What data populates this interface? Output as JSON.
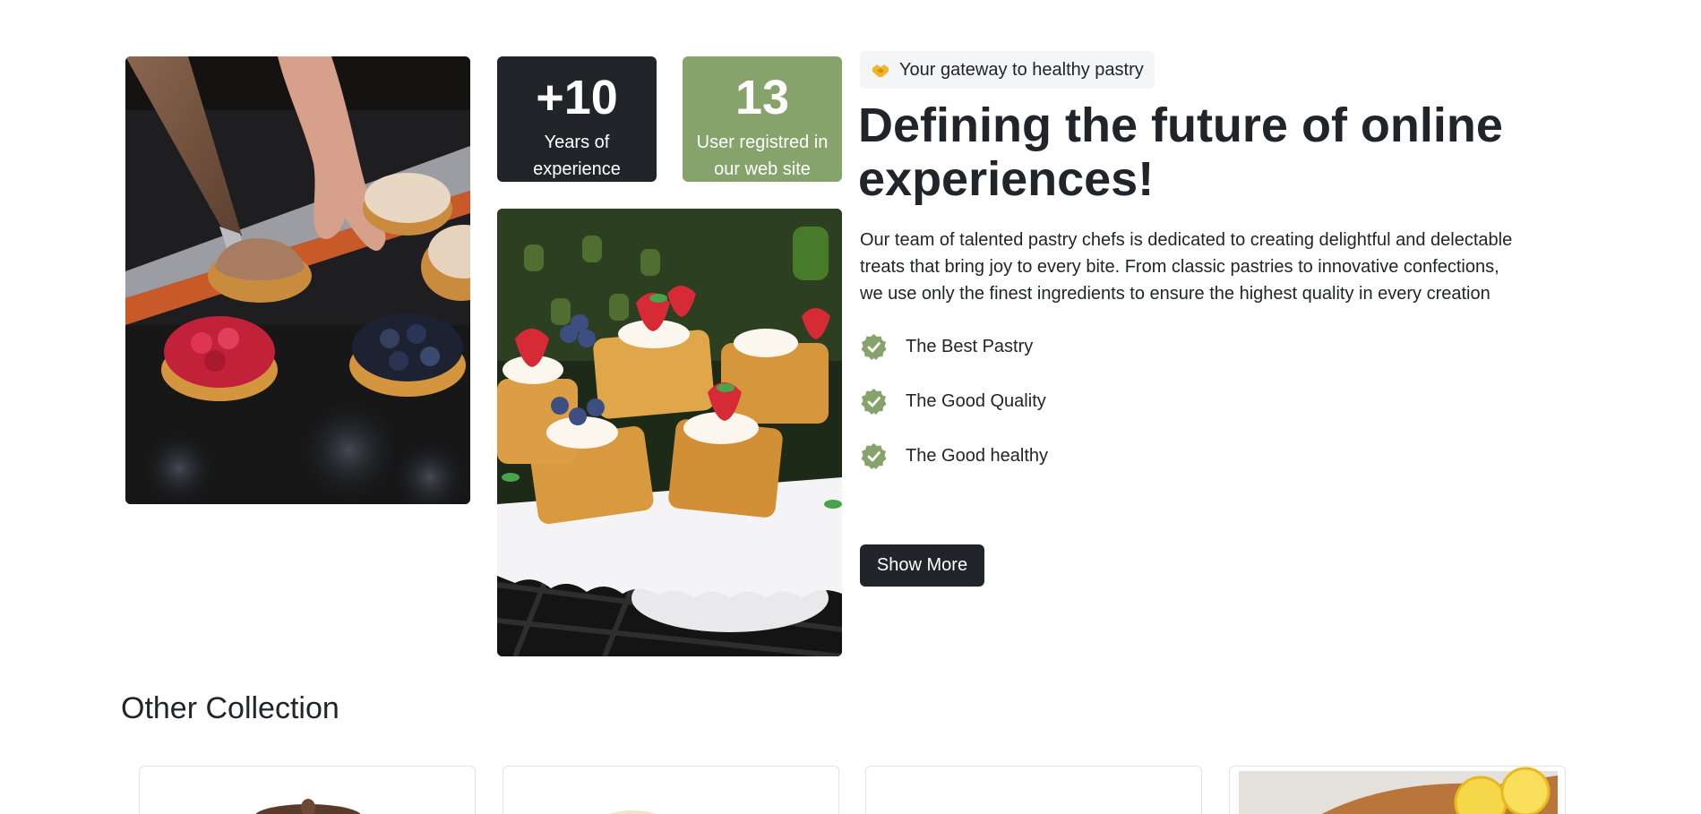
{
  "stats": [
    {
      "number": "+10",
      "label_line1": "Years of",
      "label_line2": "experience"
    },
    {
      "number": "13",
      "label_line1": "User registred in",
      "label_line2": "our web site"
    }
  ],
  "badge": {
    "icon": "handshake-icon",
    "text": "Your gateway to healthy pastry"
  },
  "headline": {
    "line1": "Defining the future of online",
    "line2": "experiences!"
  },
  "body": {
    "line1": "Our team of talented pastry chefs is dedicated to creating delightful and delectable",
    "line2": "treats that bring joy to every bite. From classic pastries to innovative confections,",
    "line3": "we use only the finest ingredients to ensure the highest quality in every creation"
  },
  "features": [
    {
      "icon": "check-badge-icon",
      "label": "The Best Pastry"
    },
    {
      "icon": "check-badge-icon",
      "label": "The Good Quality"
    },
    {
      "icon": "check-badge-icon",
      "label": "The Good healthy"
    }
  ],
  "cta": {
    "label": "Show More"
  },
  "collection": {
    "title": "Other Collection"
  },
  "colors": {
    "dark": "#212529",
    "accent_green": "#86a36c",
    "badge_bg": "#f4f5f6"
  }
}
